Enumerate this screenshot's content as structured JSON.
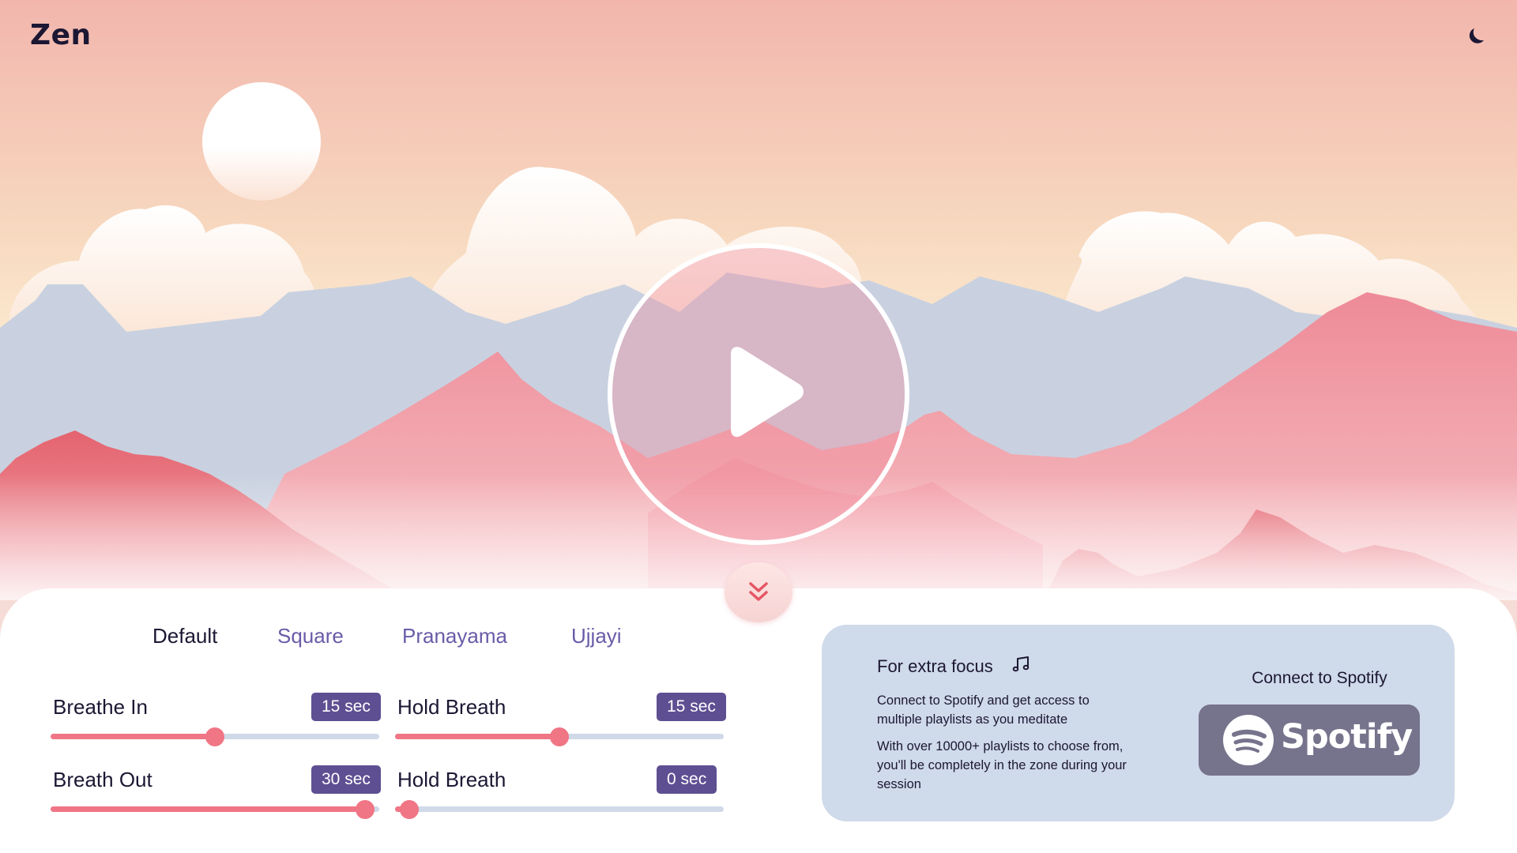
{
  "app": {
    "logo": "Zen",
    "theme_icon": "moon-icon"
  },
  "player": {
    "play_icon": "play-icon",
    "collapse_icon": "chevrons-down-icon"
  },
  "colors": {
    "accent": "#f07585",
    "badge": "#5e4f92",
    "track": "#cfd9e8",
    "card": "#cfdaea",
    "spotify_button": "#76738c",
    "text": "#1c1733",
    "tab_inactive": "#6a5ba8"
  },
  "tabs": [
    {
      "label": "Default",
      "active": true
    },
    {
      "label": "Square",
      "active": false
    },
    {
      "label": "Pranayama",
      "active": false
    },
    {
      "label": "Ujjayi",
      "active": false
    }
  ],
  "controls": [
    {
      "label": "Breathe In",
      "value": "15 sec",
      "fraction": 0.5
    },
    {
      "label": "Hold Breath",
      "value": "15 sec",
      "fraction": 0.5
    },
    {
      "label": "Breath Out",
      "value": "30 sec",
      "fraction": 1.0
    },
    {
      "label": "Hold Breath",
      "value": "0 sec",
      "fraction": 0.0
    }
  ],
  "spotify": {
    "title": "For extra focus",
    "note_icon": "music-note-icon",
    "description_1": "Connect to Spotify and get access to multiple playlists as you meditate",
    "description_2": "With over 10000+ playlists to choose from, you'll be completely in the zone during your session",
    "connect_label": "Connect to Spotify",
    "logo_icon": "spotify-logo-icon",
    "logo_text": "Spotify",
    "logo_mark": "®"
  }
}
